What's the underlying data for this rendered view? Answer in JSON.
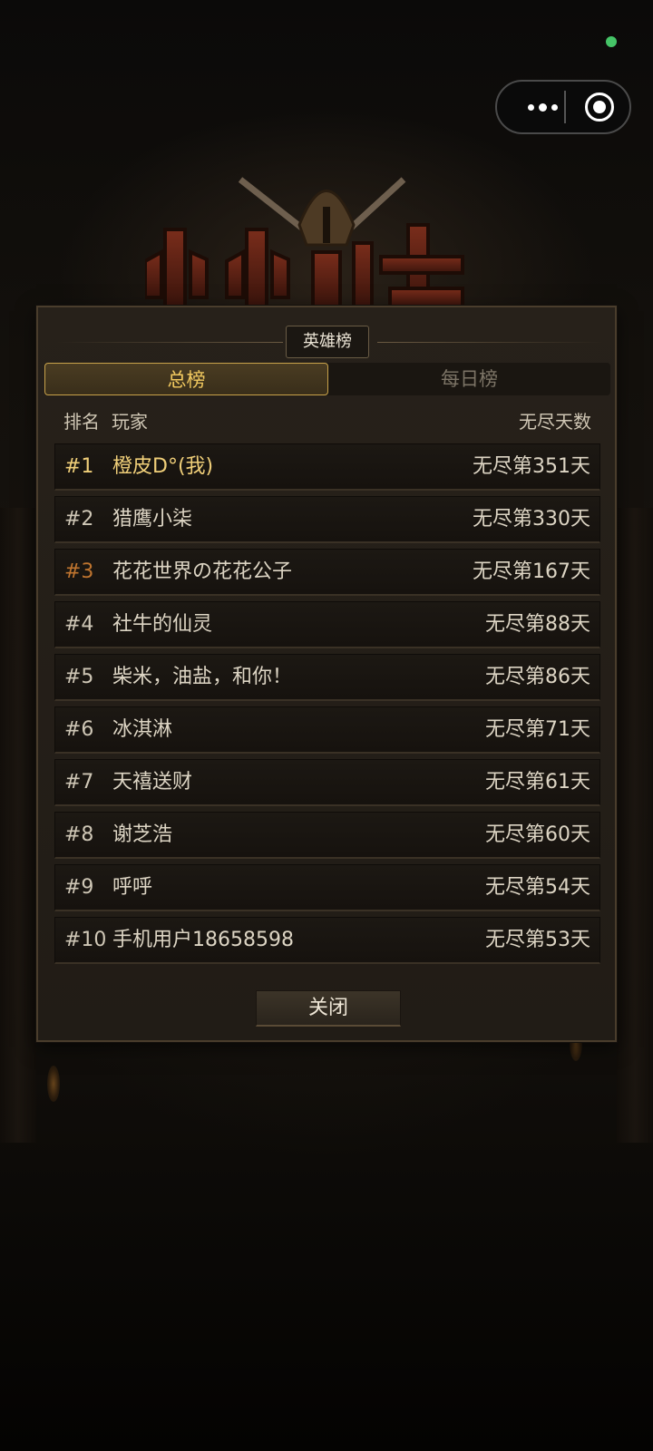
{
  "mini_program_capsule": {
    "more_icon": "more-dots-icon",
    "close_icon": "target-circle-icon"
  },
  "logo": {
    "title": "小小斗士"
  },
  "panel": {
    "title": "英雄榜",
    "tabs": [
      {
        "label": "总榜",
        "active": true
      },
      {
        "label": "每日榜",
        "active": false
      }
    ],
    "columns": {
      "rank": "排名",
      "player": "玩家",
      "score": "无尽天数"
    },
    "rows": [
      {
        "rank": "#1",
        "name": "橙皮D°(我)",
        "score": "无尽第351天"
      },
      {
        "rank": "#2",
        "name": "猎鹰小柒",
        "score": "无尽第330天"
      },
      {
        "rank": "#3",
        "name": "花花世界の花花公子",
        "score": "无尽第167天"
      },
      {
        "rank": "#4",
        "name": "社牛的仙灵",
        "score": "无尽第88天"
      },
      {
        "rank": "#5",
        "name": "柴米，油盐，和你！",
        "score": "无尽第86天"
      },
      {
        "rank": "#6",
        "name": "冰淇淋",
        "score": "无尽第71天"
      },
      {
        "rank": "#7",
        "name": "天禧送财",
        "score": "无尽第61天"
      },
      {
        "rank": "#8",
        "name": "谢芝浩",
        "score": "无尽第60天"
      },
      {
        "rank": "#9",
        "name": "呼呼",
        "score": "无尽第54天"
      },
      {
        "rank": "#10",
        "name": "手机用户18658598",
        "score": "无尽第53天"
      }
    ],
    "close_label": "关闭"
  },
  "colors": {
    "gold": "#f0cf79",
    "bronze": "#c0752f",
    "status_green": "#45c467"
  }
}
